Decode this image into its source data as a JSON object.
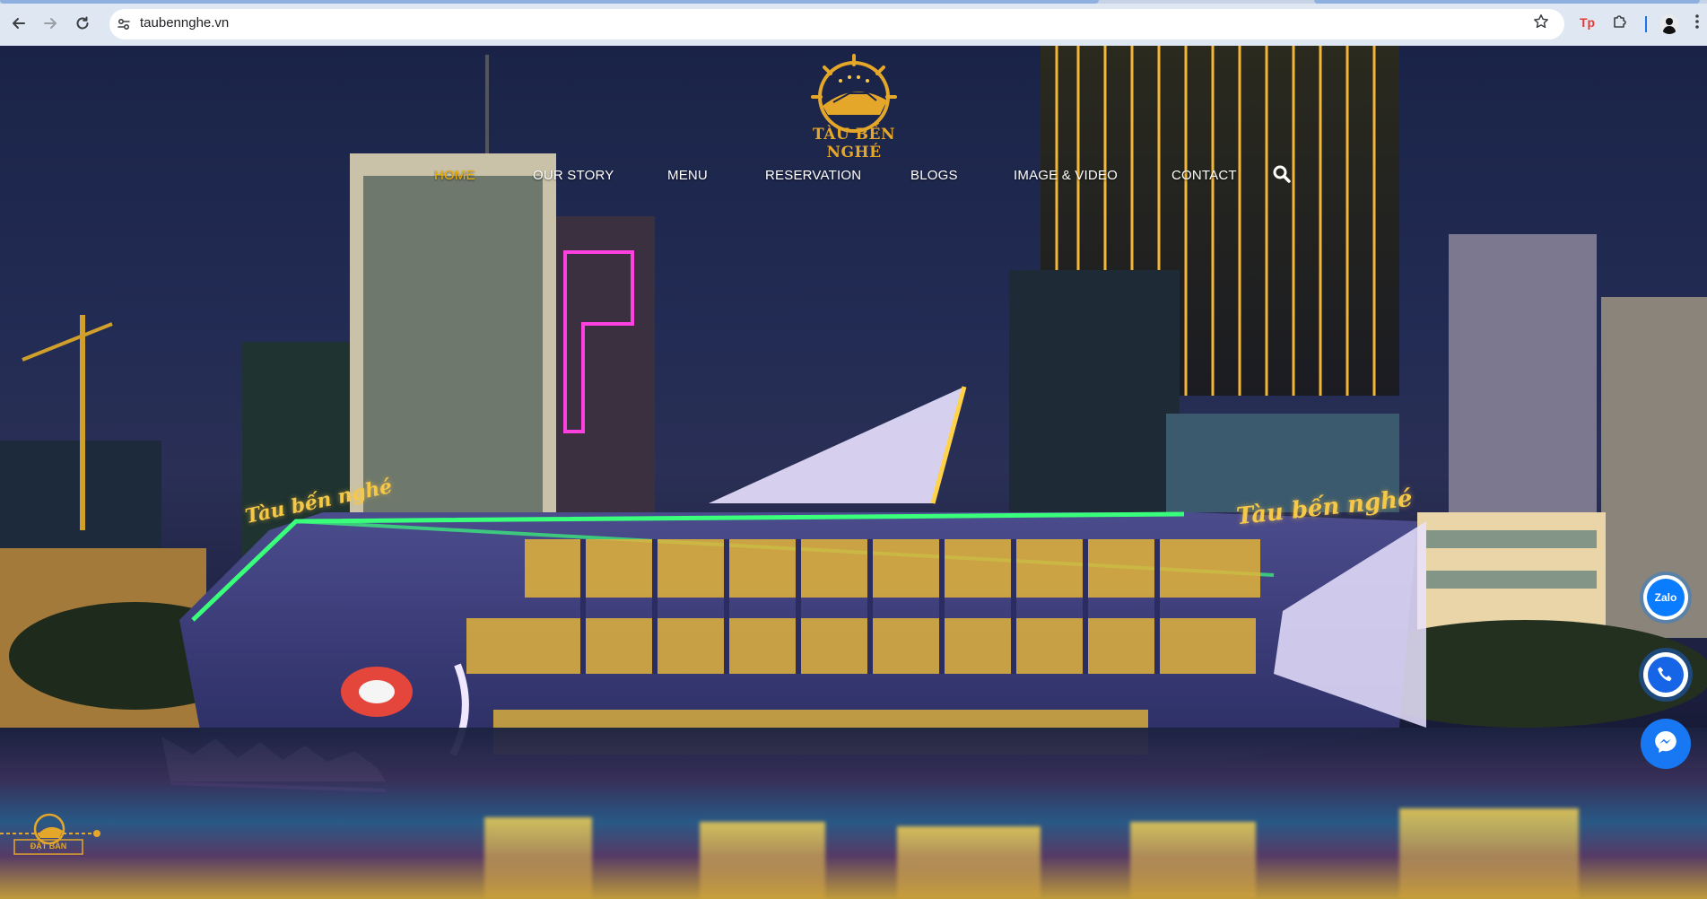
{
  "browser": {
    "url": "taubennghe.vn",
    "back_icon": "back-arrow-icon",
    "forward_icon": "forward-arrow-icon",
    "reload_icon": "reload-icon",
    "site_info_icon": "tune-icon",
    "bookmark_icon": "star-icon",
    "extension_label": "Tp",
    "extensions_icon": "puzzle-icon",
    "menu_icon": "kebab-menu-icon"
  },
  "site": {
    "logo_text": "TÀU BẾN NGHÉ",
    "nav": [
      {
        "label": "HOME",
        "active": true
      },
      {
        "label": "OUR STORY",
        "active": false
      },
      {
        "label": "MENU",
        "active": false
      },
      {
        "label": "RESERVATION",
        "active": false
      },
      {
        "label": "BLOGS",
        "active": false
      },
      {
        "label": "IMAGE & VIDEO",
        "active": false
      },
      {
        "label": "CONTACT",
        "active": false
      }
    ],
    "search_icon": "search-icon",
    "hero": {
      "boat_sign_left": "Tàu bến nghé",
      "boat_sign_right": "Tàu bến nghé"
    },
    "floating": {
      "zalo_label": "Zalo",
      "phone_icon": "phone-icon",
      "messenger_icon": "messenger-icon"
    },
    "booking_badge": "ĐẶT BÀN"
  },
  "colors": {
    "accent_gold": "#f0b000",
    "nav_text": "#ffffff",
    "zalo_blue": "#0a7cff",
    "phone_blue": "#1565e6",
    "messenger_blue": "#1877f2"
  }
}
